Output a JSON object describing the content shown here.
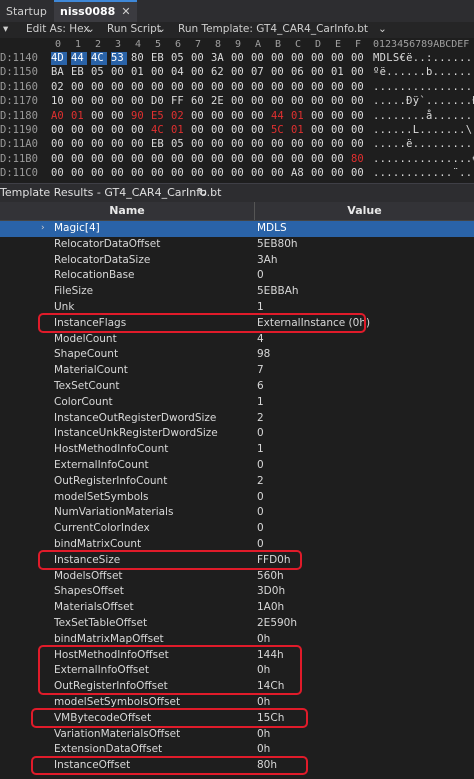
{
  "tabs": [
    {
      "label": "Startup"
    },
    {
      "label": "niss0088",
      "close": "✕"
    }
  ],
  "toolbar": {
    "pin": "▾",
    "edit_as": "Edit As: Hex",
    "edit_as_arrow": "⌄",
    "run_script": "Run Script",
    "run_script_arrow": "⌄",
    "run_template": "Run Template: GT4_CAR4_CarInfo.bt",
    "run_template_arrow": "⌄"
  },
  "hex": {
    "columns": [
      "0",
      "1",
      "2",
      "3",
      "4",
      "5",
      "6",
      "7",
      "8",
      "9",
      "A",
      "B",
      "C",
      "D",
      "E",
      "F"
    ],
    "ascii_header": "0123456789ABCDEF",
    "rows": [
      {
        "addr": "D:1140",
        "bytes": [
          "4D",
          "44",
          "4C",
          "53",
          "80",
          "EB",
          "05",
          "00",
          "3A",
          "00",
          "00",
          "00",
          "00",
          "00",
          "00",
          "00"
        ],
        "ascii": "MDLS€ë..:.......",
        "red": []
      },
      {
        "addr": "D:1150",
        "bytes": [
          "BA",
          "EB",
          "05",
          "00",
          "01",
          "00",
          "04",
          "00",
          "62",
          "00",
          "07",
          "00",
          "06",
          "00",
          "01",
          "00"
        ],
        "ascii": "ºë......b.......",
        "red": []
      },
      {
        "addr": "D:1160",
        "bytes": [
          "02",
          "00",
          "00",
          "00",
          "00",
          "00",
          "00",
          "00",
          "00",
          "00",
          "00",
          "00",
          "00",
          "00",
          "00",
          "00"
        ],
        "ascii": "................",
        "red": []
      },
      {
        "addr": "D:1170",
        "bytes": [
          "10",
          "00",
          "00",
          "00",
          "00",
          "D0",
          "FF",
          "60",
          "2E",
          "00",
          "00",
          "00",
          "00",
          "00",
          "00",
          "00"
        ],
        "ascii": ".....Ðÿ`.......Ð",
        "red": []
      },
      {
        "addr": "D:1180",
        "bytes": [
          "A0",
          "01",
          "00",
          "00",
          "90",
          "E5",
          "02",
          "00",
          "00",
          "00",
          "00",
          "44",
          "01",
          "00",
          "00",
          "00"
        ],
        "ascii": "........å.......",
        "red": [
          0,
          1,
          4,
          5,
          6,
          11,
          12
        ]
      },
      {
        "addr": "D:1190",
        "bytes": [
          "00",
          "00",
          "00",
          "00",
          "00",
          "4C",
          "01",
          "00",
          "00",
          "00",
          "00",
          "5C",
          "01",
          "00",
          "00",
          "00"
        ],
        "ascii": "......L.......\\.",
        "red": [
          5,
          6,
          11,
          12
        ]
      },
      {
        "addr": "D:11A0",
        "bytes": [
          "00",
          "00",
          "00",
          "00",
          "00",
          "EB",
          "05",
          "00",
          "00",
          "00",
          "00",
          "00",
          "00",
          "00",
          "00",
          "00"
        ],
        "ascii": ".....ë..........",
        "red": []
      },
      {
        "addr": "D:11B0",
        "bytes": [
          "00",
          "00",
          "00",
          "00",
          "00",
          "00",
          "00",
          "00",
          "00",
          "00",
          "00",
          "00",
          "00",
          "00",
          "00",
          "80"
        ],
        "ascii": "...............€",
        "red": [
          15
        ]
      },
      {
        "addr": "D:11C0",
        "bytes": [
          "00",
          "00",
          "00",
          "00",
          "00",
          "00",
          "00",
          "00",
          "00",
          "00",
          "00",
          "00",
          "A8",
          "00",
          "00",
          "00"
        ],
        "ascii": "............¨...",
        "red": []
      }
    ]
  },
  "template_results": {
    "title": "Template Results - GT4_CAR4_CarInfo.bt",
    "refresh_icon": "↻",
    "header_name": "Name",
    "header_value": "Value",
    "rows": [
      {
        "name": "Magic[4]",
        "value": "MDLS"
      },
      {
        "name": "RelocatorDataOffset",
        "value": "5EB80h"
      },
      {
        "name": "RelocatorDataSize",
        "value": "3Ah"
      },
      {
        "name": "RelocationBase",
        "value": "0"
      },
      {
        "name": "FileSize",
        "value": "5EBBAh"
      },
      {
        "name": "Unk",
        "value": "1"
      },
      {
        "name": "InstanceFlags",
        "value": "ExternalInstance (0h)"
      },
      {
        "name": "ModelCount",
        "value": "4"
      },
      {
        "name": "ShapeCount",
        "value": "98"
      },
      {
        "name": "MaterialCount",
        "value": "7"
      },
      {
        "name": "TexSetCount",
        "value": "6"
      },
      {
        "name": "ColorCount",
        "value": "1"
      },
      {
        "name": "InstanceOutRegisterDwordSize",
        "value": "2"
      },
      {
        "name": "InstanceUnkRegisterDwordSize",
        "value": "0"
      },
      {
        "name": "HostMethodInfoCount",
        "value": "1"
      },
      {
        "name": "ExternalInfoCount",
        "value": "0"
      },
      {
        "name": "OutRegisterInfoCount",
        "value": "2"
      },
      {
        "name": "modelSetSymbols",
        "value": "0"
      },
      {
        "name": "NumVariationMaterials",
        "value": "0"
      },
      {
        "name": "CurrentColorIndex",
        "value": "0"
      },
      {
        "name": "bindMatrixCount",
        "value": "0"
      },
      {
        "name": "InstanceSize",
        "value": "FFD0h"
      },
      {
        "name": "ModelsOffset",
        "value": "560h"
      },
      {
        "name": "ShapesOffset",
        "value": "3D0h"
      },
      {
        "name": "MaterialsOffset",
        "value": "1A0h"
      },
      {
        "name": "TexSetTableOffset",
        "value": "2E590h"
      },
      {
        "name": "bindMatrixMapOffset",
        "value": "0h"
      },
      {
        "name": "HostMethodInfoOffset",
        "value": "144h"
      },
      {
        "name": "ExternalInfoOffset",
        "value": "0h"
      },
      {
        "name": "OutRegisterInfoOffset",
        "value": "14Ch"
      },
      {
        "name": "modelSetSymbolsOffset",
        "value": "0h"
      },
      {
        "name": "VMBytecodeOffset",
        "value": "15Ch"
      },
      {
        "name": "VariationMaterialsOffset",
        "value": "0h"
      },
      {
        "name": "ExtensionDataOffset",
        "value": "0h"
      },
      {
        "name": "InstanceOffset",
        "value": "80h"
      }
    ]
  },
  "colors": {
    "selection": "#2a63a8",
    "highlight_box": "#e01b2a",
    "changed_byte": "#e03030"
  }
}
